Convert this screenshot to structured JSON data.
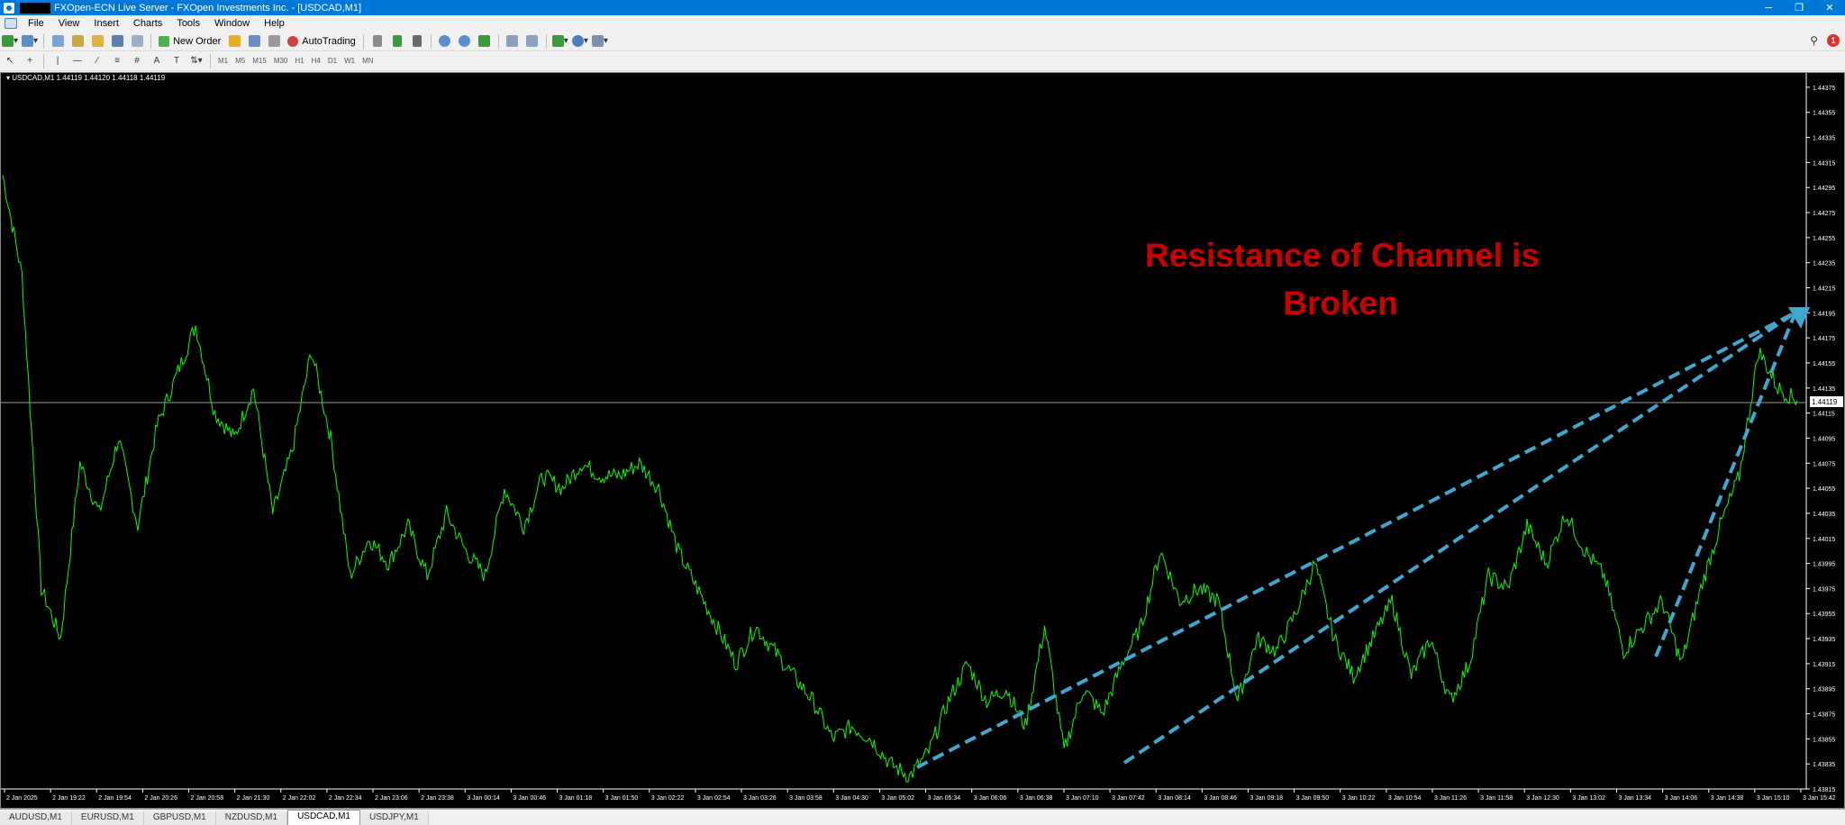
{
  "window": {
    "title": "FXOpen-ECN Live Server - FXOpen Investments Inc. - [USDCAD,M1]",
    "controls": [
      "─",
      "❐",
      "✕"
    ]
  },
  "menu": {
    "items": [
      "File",
      "View",
      "Insert",
      "Charts",
      "Tools",
      "Window",
      "Help"
    ]
  },
  "toolbar": {
    "new_order_label": "New Order",
    "autotrading_label": "AutoTrading",
    "timeframes": [
      "M1",
      "M5",
      "M15",
      "M30",
      "H1",
      "H4",
      "D1",
      "W1",
      "MN"
    ],
    "alert_count": "1"
  },
  "chart": {
    "header": "USDCAD,M1  1.44119 1.44120 1.44118 1.44119",
    "current_price": "1.44119",
    "annotation_line1": "Resistance of Channel is",
    "annotation_line2": "Broken",
    "colors": {
      "background": "#000000",
      "price_line": "#00ff00",
      "annotation": "#cc0000",
      "trend_lines": "#3fa8d0"
    }
  },
  "chart_data": {
    "type": "line",
    "symbol": "USDCAD",
    "timeframe": "M1",
    "y_ticks": [
      "1.44375",
      "1.44355",
      "1.44335",
      "1.44315",
      "1.44295",
      "1.44275",
      "1.44255",
      "1.44235",
      "1.44215",
      "1.44195",
      "1.44175",
      "1.44155",
      "1.44135",
      "1.44115",
      "1.44095",
      "1.44075",
      "1.44055",
      "1.44035",
      "1.44015",
      "1.43995",
      "1.43975",
      "1.43955",
      "1.43935",
      "1.43915",
      "1.43895",
      "1.43875",
      "1.43855",
      "1.43835",
      "1.43815"
    ],
    "x_ticks": [
      "2 Jan 2025",
      "2 Jan 19:22",
      "2 Jan 19:54",
      "2 Jan 20:26",
      "2 Jan 20:58",
      "2 Jan 21:30",
      "2 Jan 22:02",
      "2 Jan 22:34",
      "2 Jan 23:06",
      "2 Jan 23:38",
      "3 Jan 00:14",
      "3 Jan 00:46",
      "3 Jan 01:18",
      "3 Jan 01:50",
      "3 Jan 02:22",
      "3 Jan 02:54",
      "3 Jan 03:26",
      "3 Jan 03:58",
      "3 Jan 04:30",
      "3 Jan 05:02",
      "3 Jan 05:34",
      "3 Jan 06:06",
      "3 Jan 06:38",
      "3 Jan 07:10",
      "3 Jan 07:42",
      "3 Jan 08:14",
      "3 Jan 08:46",
      "3 Jan 09:18",
      "3 Jan 09:50",
      "3 Jan 10:22",
      "3 Jan 10:54",
      "3 Jan 11:26",
      "3 Jan 11:58",
      "3 Jan 12:30",
      "3 Jan 13:02",
      "3 Jan 13:34",
      "3 Jan 14:06",
      "3 Jan 14:38",
      "3 Jan 15:10",
      "3 Jan 15:42"
    ],
    "ylim": [
      1.43815,
      1.44385
    ],
    "series": [
      {
        "values": [
          1.44305,
          1.44225,
          1.43975,
          1.43935,
          1.44075,
          1.44035,
          1.44095,
          1.44025,
          1.44105,
          1.44145,
          1.44185,
          1.44115,
          1.44095,
          1.44135,
          1.44035,
          1.44085,
          1.44165,
          1.44095,
          1.43985,
          1.44015,
          1.43995,
          1.44025,
          1.43985,
          1.44035,
          1.44005,
          1.43985,
          1.44055,
          1.44025,
          1.44065,
          1.44055,
          1.44075,
          1.44065,
          1.44065,
          1.44075,
          1.44055,
          1.44005,
          1.43975,
          1.43945,
          1.43915,
          1.43945,
          1.43925,
          1.43905,
          1.43885,
          1.43855,
          1.43865,
          1.43855,
          1.43835,
          1.43825,
          1.43845,
          1.43885,
          1.43915,
          1.43885,
          1.43895,
          1.43865,
          1.43945,
          1.43845,
          1.43895,
          1.43875,
          1.43915,
          1.43945,
          1.44005,
          1.43965,
          1.43975,
          1.43965,
          1.43885,
          1.43935,
          1.43925,
          1.43955,
          1.43995,
          1.43935,
          1.43905,
          1.43935,
          1.43965,
          1.43905,
          1.43935,
          1.43885,
          1.43915,
          1.43985,
          1.43975,
          1.44025,
          1.43995,
          1.44035,
          1.44005,
          1.43985,
          1.43925,
          1.43945,
          1.43965,
          1.43915,
          1.43975,
          1.44025,
          1.44065,
          1.44165,
          1.44135,
          1.44125
        ]
      }
    ],
    "grid": false
  },
  "tabs": [
    "AUDUSD,M1",
    "EURUSD,M1",
    "GBPUSD,M1",
    "NZDUSD,M1",
    "USDCAD,M1",
    "USDJPY,M1"
  ],
  "active_tab": "USDCAD,M1"
}
